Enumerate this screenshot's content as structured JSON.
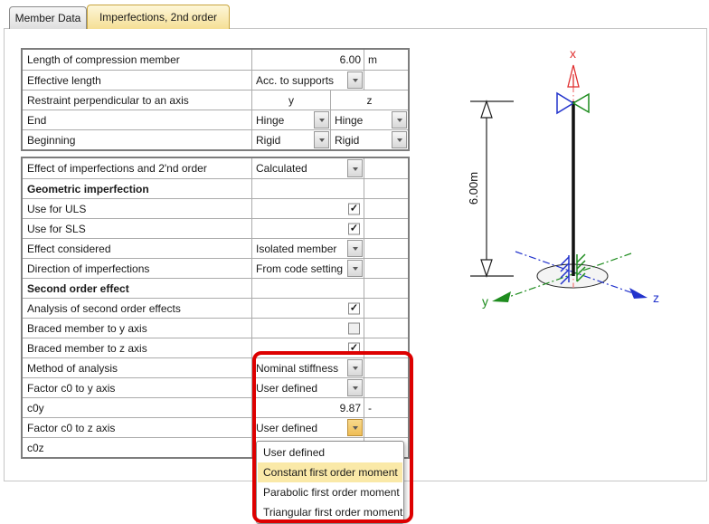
{
  "tabs": [
    {
      "label": "Member Data",
      "active": false
    },
    {
      "label": "Imperfections, 2nd order",
      "active": true
    }
  ],
  "table1": {
    "rows": [
      {
        "label": "Length of compression member",
        "type": "value",
        "value": "6.00",
        "unit": "m"
      },
      {
        "label": "Effective length",
        "type": "dropdown",
        "value": "Acc. to supports"
      },
      {
        "label": "Restraint perpendicular to an axis",
        "type": "split-header",
        "y": "y",
        "z": "z"
      },
      {
        "label": "End",
        "type": "split-dropdown",
        "y": "Hinge",
        "z": "Hinge"
      },
      {
        "label": "Beginning",
        "type": "split-dropdown",
        "y": "Rigid",
        "z": "Rigid"
      }
    ]
  },
  "table2": {
    "rows": [
      {
        "label": "Effect of imperfections and 2'nd order",
        "type": "dropdown",
        "value": "Calculated"
      },
      {
        "label": "Geometric imperfection",
        "type": "section"
      },
      {
        "label": "Use for ULS",
        "type": "checkbox",
        "checked": true
      },
      {
        "label": "Use for SLS",
        "type": "checkbox",
        "checked": true
      },
      {
        "label": "Effect considered",
        "type": "dropdown",
        "value": "Isolated member"
      },
      {
        "label": "Direction of imperfections",
        "type": "dropdown",
        "value": "From code setting"
      },
      {
        "label": "Second order effect",
        "type": "section"
      },
      {
        "label": "Analysis of second order effects",
        "type": "checkbox",
        "checked": true
      },
      {
        "label": "Braced member to y axis",
        "type": "checkbox",
        "checked": false
      },
      {
        "label": "Braced member to z axis",
        "type": "checkbox",
        "checked": true
      },
      {
        "label": "Method of analysis",
        "type": "dropdown",
        "value": "Nominal stiffness"
      },
      {
        "label": "Factor c0 to y axis",
        "type": "dropdown",
        "value": "User defined"
      },
      {
        "label": "c0y",
        "type": "value",
        "value": "9.87",
        "unit": "-"
      },
      {
        "label": "Factor c0 to z axis",
        "type": "dropdown",
        "value": "User defined",
        "open": true
      },
      {
        "label": "c0z",
        "type": "value",
        "value": "",
        "unit": ""
      }
    ]
  },
  "popup": {
    "items": [
      {
        "label": "User defined",
        "highlighted": false
      },
      {
        "label": "Constant first order moment",
        "highlighted": true
      },
      {
        "label": "Parabolic first order moment",
        "highlighted": false
      },
      {
        "label": "Triangular first order moment",
        "highlighted": false
      }
    ]
  },
  "diagram": {
    "dimension_label": "6.00m",
    "axis_x_label": "x",
    "axis_y_label": "y",
    "axis_z_label": "z"
  },
  "colors": {
    "active_tab": "#f5df95",
    "popup_highlight": "#fae9a8",
    "annotation_red": "#dd0000",
    "open_dropdown_button": "#efbd55",
    "axis_x": "#e03030",
    "axis_y": "#1e8c1e",
    "axis_z": "#2233cc"
  }
}
